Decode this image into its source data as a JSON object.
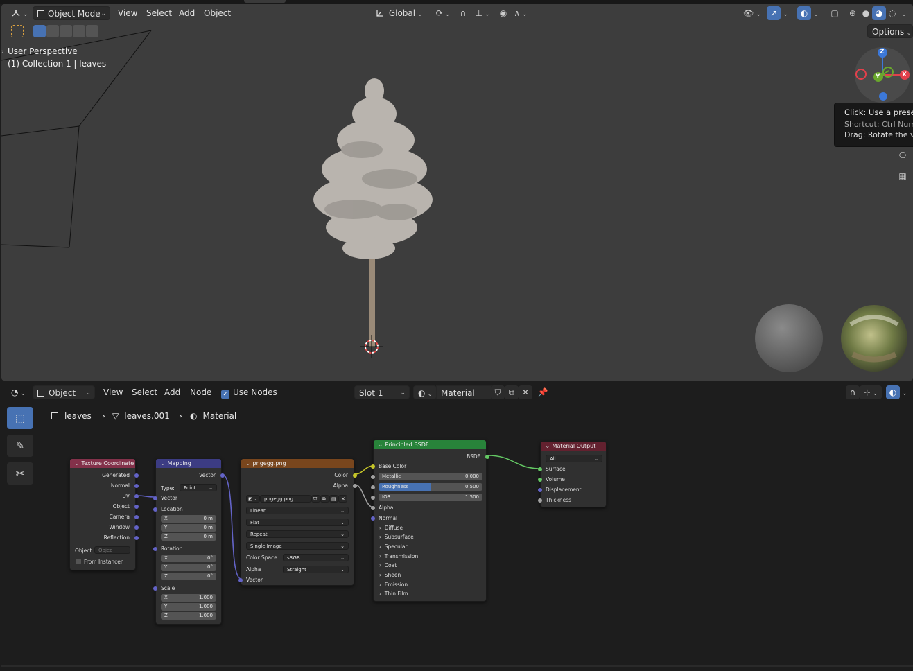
{
  "viewport": {
    "mode": "Object Mode",
    "menus": [
      "View",
      "Select",
      "Add",
      "Object"
    ],
    "transform_orientation": "Global",
    "options_label": "Options",
    "perspective_label": "User Perspective",
    "collection_label": "(1) Collection 1 | leaves",
    "gizmo_axes": {
      "z": "Z",
      "y": "Y",
      "x": "X"
    },
    "tooltip": {
      "line1": "Click: Use a preset",
      "line2": "Shortcut: Ctrl Num",
      "line3": "Drag: Rotate the vie"
    }
  },
  "node_editor": {
    "object_menu": "Object",
    "menus": [
      "View",
      "Select",
      "Add",
      "Node"
    ],
    "use_nodes_label": "Use Nodes",
    "use_nodes_checked": true,
    "slot": "Slot 1",
    "material_name": "Material",
    "breadcrumb": {
      "object": "leaves",
      "mesh": "leaves.001",
      "material": "Material"
    },
    "nodes": {
      "texcoord": {
        "title": "Texture Coordinate",
        "outputs": [
          "Generated",
          "Normal",
          "UV",
          "Object",
          "Camera",
          "Window",
          "Reflection"
        ],
        "object_label": "Object:",
        "object_placeholder": "Objec",
        "from_instancer": "From Instancer"
      },
      "mapping": {
        "title": "Mapping",
        "output": "Vector",
        "type_label": "Type:",
        "type_value": "Point",
        "vector": "Vector",
        "location": "Location",
        "loc": [
          {
            "a": "X",
            "v": "0 m"
          },
          {
            "a": "Y",
            "v": "0 m"
          },
          {
            "a": "Z",
            "v": "0 m"
          }
        ],
        "rotation": "Rotation",
        "rot": [
          {
            "a": "X",
            "v": "0°"
          },
          {
            "a": "Y",
            "v": "0°"
          },
          {
            "a": "Z",
            "v": "0°"
          }
        ],
        "scale": "Scale",
        "scl": [
          {
            "a": "X",
            "v": "1.000"
          },
          {
            "a": "Y",
            "v": "1.000"
          },
          {
            "a": "Z",
            "v": "1.000"
          }
        ]
      },
      "image": {
        "title": "pngegg.png",
        "out_color": "Color",
        "out_alpha": "Alpha",
        "image_name": "pngegg.png",
        "interpolation": "Linear",
        "projection": "Flat",
        "extension": "Repeat",
        "source": "Single Image",
        "colorspace_label": "Color Space",
        "colorspace": "sRGB",
        "alpha_label": "Alpha",
        "alpha": "Straight",
        "input_vector": "Vector"
      },
      "bsdf": {
        "title": "Principled BSDF",
        "output": "BSDF",
        "base_color": "Base Color",
        "metallic_label": "Metallic",
        "metallic": "0.000",
        "roughness_label": "Roughness",
        "roughness": "0.500",
        "roughness_fraction": 0.5,
        "ior_label": "IOR",
        "ior": "1.500",
        "alpha": "Alpha",
        "normal": "Normal",
        "panels": [
          "Diffuse",
          "Subsurface",
          "Specular",
          "Transmission",
          "Coat",
          "Sheen",
          "Emission",
          "Thin Film"
        ]
      },
      "output": {
        "title": "Material Output",
        "target": "All",
        "inputs": [
          "Surface",
          "Volume",
          "Displacement",
          "Thickness"
        ]
      }
    }
  },
  "colors": {
    "accent": "#4772b3",
    "header_input": "#83314a",
    "header_vector": "#3c3c83",
    "header_texture": "#79461d",
    "header_shader": "#28833a",
    "header_output": "#63212f"
  }
}
